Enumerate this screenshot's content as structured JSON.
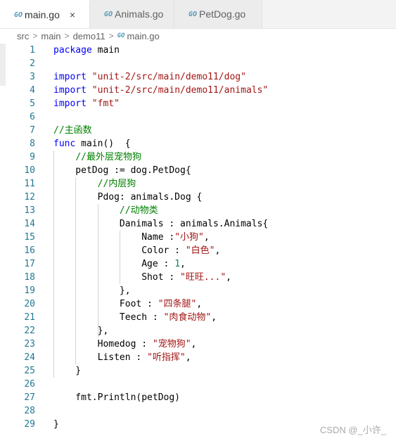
{
  "tabs": [
    {
      "icon": "go-file-icon",
      "icon_text": "GO",
      "label": "main.go",
      "active": true,
      "close": "×"
    },
    {
      "icon": "go-file-icon",
      "icon_text": "GO",
      "label": "Animals.go",
      "active": false
    },
    {
      "icon": "go-file-icon",
      "icon_text": "GO",
      "label": "PetDog.go",
      "active": false
    }
  ],
  "breadcrumb": {
    "parts": [
      "src",
      "main",
      "demo11"
    ],
    "separator": ">",
    "file_icon_text": "GO",
    "file": "main.go"
  },
  "code": {
    "line_numbers": [
      "1",
      "2",
      "3",
      "4",
      "5",
      "6",
      "7",
      "8",
      "9",
      "10",
      "11",
      "12",
      "13",
      "14",
      "15",
      "16",
      "17",
      "18",
      "19",
      "20",
      "21",
      "22",
      "23",
      "24",
      "25",
      "26",
      "27",
      "28",
      "29"
    ],
    "lines": [
      "package main",
      "",
      "import \"unit-2/src/main/demo11/dog\"",
      "import \"unit-2/src/main/demo11/animals\"",
      "import \"fmt\"",
      "",
      "//主函数",
      "func main()  {",
      "    //最外层宠物狗",
      "    petDog := dog.PetDog{",
      "        //内层狗",
      "        Pdog: animals.Dog {",
      "            //动物类",
      "            Danimals : animals.Animals{",
      "                Name :\"小狗\",",
      "                Color : \"白色\",",
      "                Age : 1,",
      "                Shot : \"旺旺...\",",
      "            },",
      "            Foot : \"四条腿\",",
      "            Teech : \"肉食动物\",",
      "        },",
      "        Homedog : \"宠物狗\",",
      "        Listen : \"听指挥\",",
      "    }",
      "",
      "    fmt.Println(petDog)",
      "",
      "}"
    ]
  },
  "watermark": "CSDN @_小许_",
  "colors": {
    "keyword": "#0000ff",
    "string": "#a31515",
    "comment": "#008000",
    "line_number": "#237893",
    "go_icon": "#519aba"
  }
}
